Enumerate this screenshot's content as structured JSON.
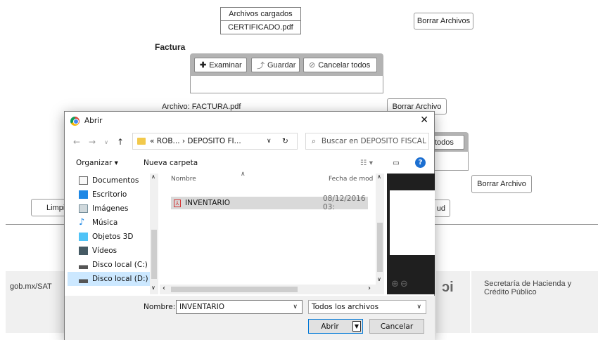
{
  "page": {
    "loaded_files_header": "Archivos cargados",
    "loaded_file_1": "CERTIFICADO.pdf",
    "delete_files_top": "Borrar Archivos",
    "factura_label": "Factura",
    "browse_label": "Examinar",
    "save_label": "Guardar",
    "cancel_all_label": "Cancelar todos",
    "file_info": "Archivo: FACTURA.pdf",
    "delete_file_1": "Borrar Archivo",
    "cancel_all_label_2": "todos",
    "delete_file_2": "Borrar Archivo",
    "clear_partial": "Limpi",
    "request_partial": "ud",
    "footer_left": "gob.mx/SAT",
    "footer_right": "Secretaría de Hacienda y Crédito Público"
  },
  "dialog": {
    "title": "Abrir",
    "breadcrumb": "«  ROB...  ›  DEPOSITO FI...",
    "search_placeholder": "Buscar en DEPOSITO FISCAL",
    "organize": "Organizar ▾",
    "new_folder": "Nueva carpeta",
    "nav_items": [
      {
        "label": "Documentos",
        "icon": "documents-icon"
      },
      {
        "label": "Escritorio",
        "icon": "desktop-icon"
      },
      {
        "label": "Imágenes",
        "icon": "pictures-icon"
      },
      {
        "label": "Música",
        "icon": "music-icon"
      },
      {
        "label": "Objetos 3D",
        "icon": "3d-objects-icon"
      },
      {
        "label": "Vídeos",
        "icon": "videos-icon"
      },
      {
        "label": "Disco local (C:)",
        "icon": "drive-icon"
      },
      {
        "label": "Disco local (D:)",
        "icon": "drive-icon"
      }
    ],
    "col_name": "Nombre",
    "col_date": "Fecha de mod",
    "file_name": "INVENTARIO",
    "file_date": "08/12/2016 03:",
    "name_label": "Nombre:",
    "name_value": "INVENTARIO",
    "filter_value": "Todos los archivos",
    "open_btn": "Abrir",
    "cancel_btn": "Cancelar"
  }
}
